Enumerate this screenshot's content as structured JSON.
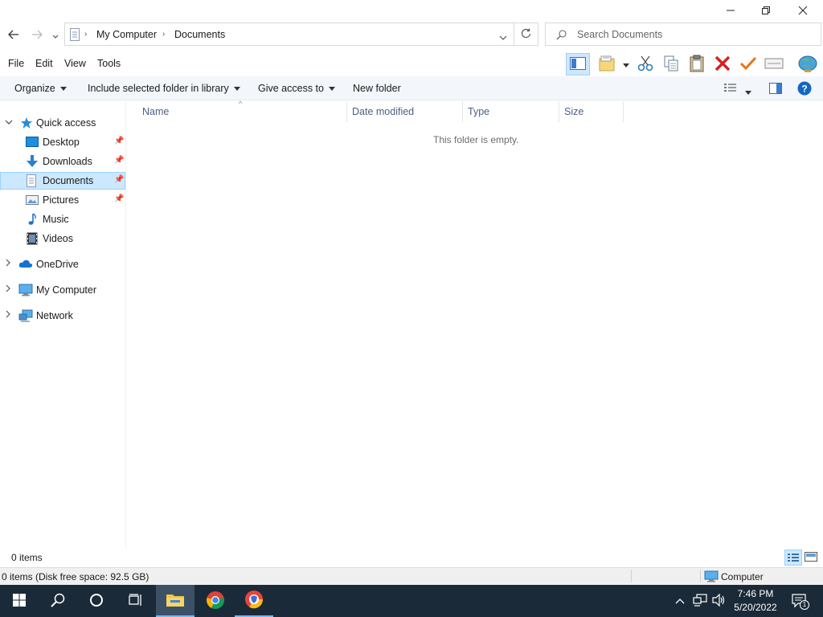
{
  "window": {
    "caption_buttons": [
      "minimize-icon",
      "restore-icon",
      "close-icon"
    ]
  },
  "address": {
    "breadcrumb": [
      "My Computer",
      "Documents"
    ],
    "search_placeholder": "Search Documents"
  },
  "menu": {
    "items": [
      "File",
      "Edit",
      "View",
      "Tools"
    ]
  },
  "toolbar": {
    "icons": [
      "preview-pane-icon",
      "folder-options-icon",
      "cut-icon",
      "copy-icon",
      "paste-icon",
      "delete-icon",
      "check-icon",
      "rename-icon",
      "globe-icon"
    ]
  },
  "commandbar": {
    "organize": "Organize",
    "include_library": "Include selected folder in library",
    "give_access": "Give access to",
    "new_folder": "New folder"
  },
  "navpane": {
    "quick_access": "Quick access",
    "quick_items": [
      {
        "label": "Desktop",
        "icon": "desktop-icon"
      },
      {
        "label": "Downloads",
        "icon": "download-icon"
      },
      {
        "label": "Documents",
        "icon": "documents-icon"
      },
      {
        "label": "Pictures",
        "icon": "pictures-icon"
      },
      {
        "label": "Music",
        "icon": "music-icon"
      },
      {
        "label": "Videos",
        "icon": "videos-icon"
      }
    ],
    "onedrive": "OneDrive",
    "my_computer": "My Computer",
    "network": "Network"
  },
  "content": {
    "columns": [
      "Name",
      "Date modified",
      "Type",
      "Size"
    ],
    "empty_message": "This folder is empty."
  },
  "status": {
    "item_count": "0 items",
    "details": "0 items (Disk free space: 92.5 GB)",
    "location": "Computer"
  },
  "taskbar": {
    "time": "7:46 PM",
    "date": "5/20/2022",
    "notification_count": "1"
  },
  "colors": {
    "accent": "#0078d7",
    "selection": "#cce8ff",
    "taskbar": "#1b2a38",
    "delete_red": "#d81e1e",
    "check_orange": "#e8751a"
  }
}
